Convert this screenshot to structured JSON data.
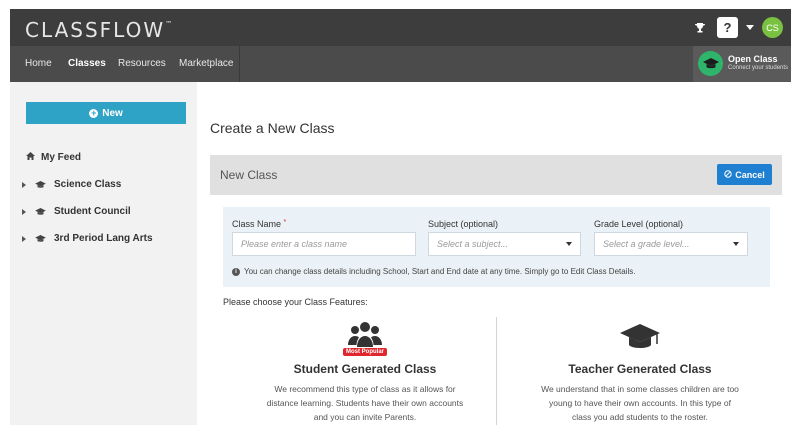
{
  "header": {
    "logo": "CLASSFLOW",
    "logo_tm": "™",
    "help_label": "?",
    "user_initials": "CS"
  },
  "nav": {
    "tabs": [
      {
        "label": "Home",
        "active": false
      },
      {
        "label": "Classes",
        "active": true
      },
      {
        "label": "Resources",
        "active": false
      },
      {
        "label": "Marketplace",
        "active": false
      }
    ],
    "open_class": {
      "title": "Open Class",
      "subtitle": "Connect your students"
    }
  },
  "sidebar": {
    "new_label": "New",
    "feed_label": "My Feed",
    "classes": [
      {
        "label": "Science Class"
      },
      {
        "label": "Student Council"
      },
      {
        "label": "3rd Period Lang Arts"
      }
    ]
  },
  "main": {
    "title": "Create a New Class",
    "panel_title": "New Class",
    "cancel_label": "Cancel",
    "form": {
      "class_name_label": "Class Name",
      "required_mark": "*",
      "class_name_placeholder": "Please enter a class name",
      "subject_label": "Subject (optional)",
      "subject_placeholder": "Select a subject...",
      "grade_label": "Grade Level (optional)",
      "grade_placeholder": "Select a grade level...",
      "info_text": "You can change class details including School, Start and End date at any time. Simply go to Edit Class Details."
    },
    "choose_text": "Please choose your Class Features:",
    "features": [
      {
        "badge": "Most Popular",
        "title": "Student Generated Class",
        "description": "We recommend this type of class as it allows for distance learning. Students have their own accounts and you can invite Parents."
      },
      {
        "title": "Teacher Generated Class",
        "description": "We understand that in some classes children are too young to have their own accounts. In this type of class you add students to the roster."
      }
    ]
  },
  "colors": {
    "header_bg": "#3d3d3d",
    "nav_bg": "#4b4b4b",
    "new_button": "#2fa3c6",
    "cancel_button": "#1f7fd0",
    "open_class_icon": "#2fb56b",
    "avatar": "#7ac142",
    "badge": "#e0262e"
  },
  "icons": {
    "trophy": "trophy-icon",
    "open_class": "graduation-cap-icon",
    "feed": "home-icon",
    "class": "graduation-cap-icon",
    "cancel": "cancel-circle-icon",
    "info": "info-icon",
    "student_feature": "users-group-icon",
    "teacher_feature": "graduation-cap-icon"
  }
}
